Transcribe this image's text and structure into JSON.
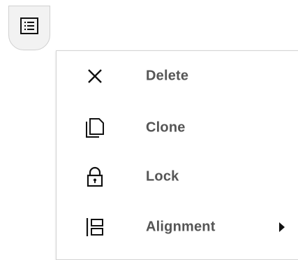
{
  "trigger": {
    "icon": "list-menu-icon"
  },
  "menu": {
    "items": [
      {
        "label": "Delete",
        "icon": "close-icon"
      },
      {
        "label": "Clone",
        "icon": "copy-icon"
      },
      {
        "label": "Lock",
        "icon": "lock-icon"
      },
      {
        "label": "Alignment",
        "icon": "align-left-icon",
        "submenu_indicator": "chevron-right-icon"
      }
    ]
  },
  "colors": {
    "label_text": "#555555",
    "icon": "#111111",
    "trigger_background": "#f2f2f2",
    "menu_border": "#d4d4d4"
  }
}
